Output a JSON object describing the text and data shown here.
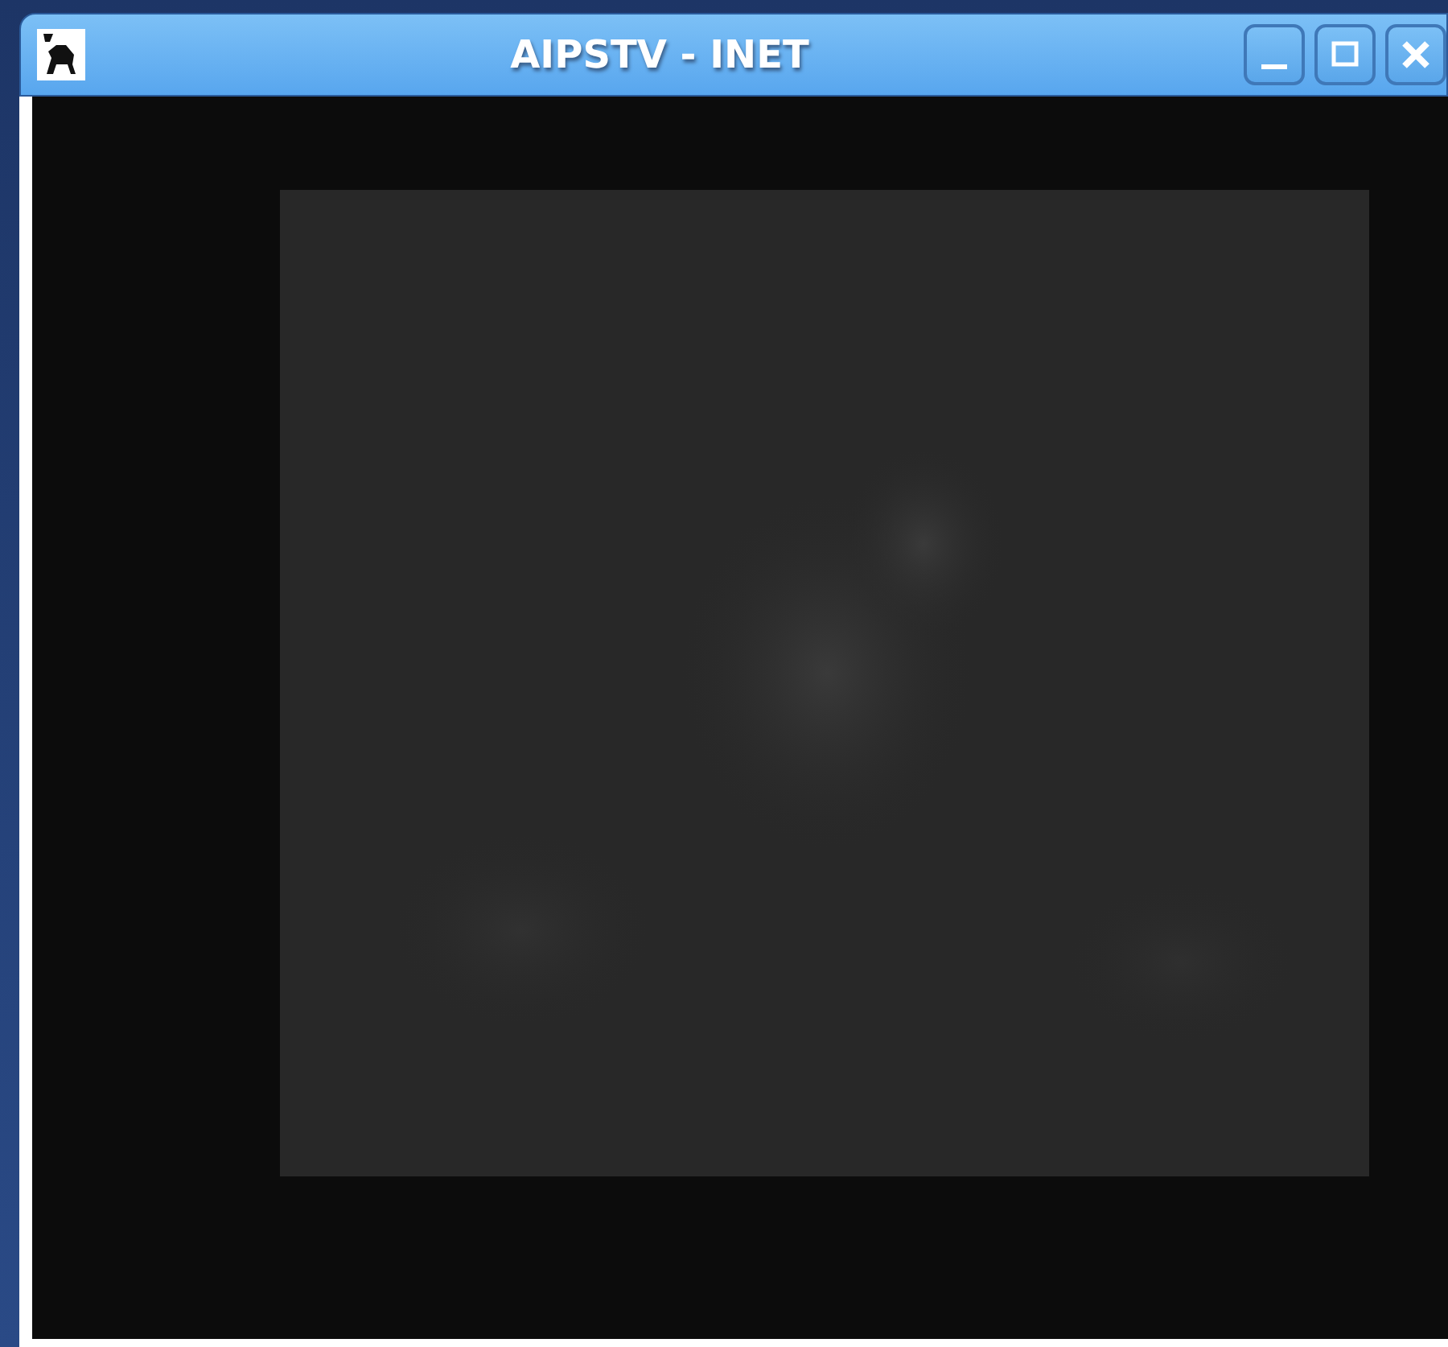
{
  "window": {
    "title": "AIPSTV - INET"
  }
}
